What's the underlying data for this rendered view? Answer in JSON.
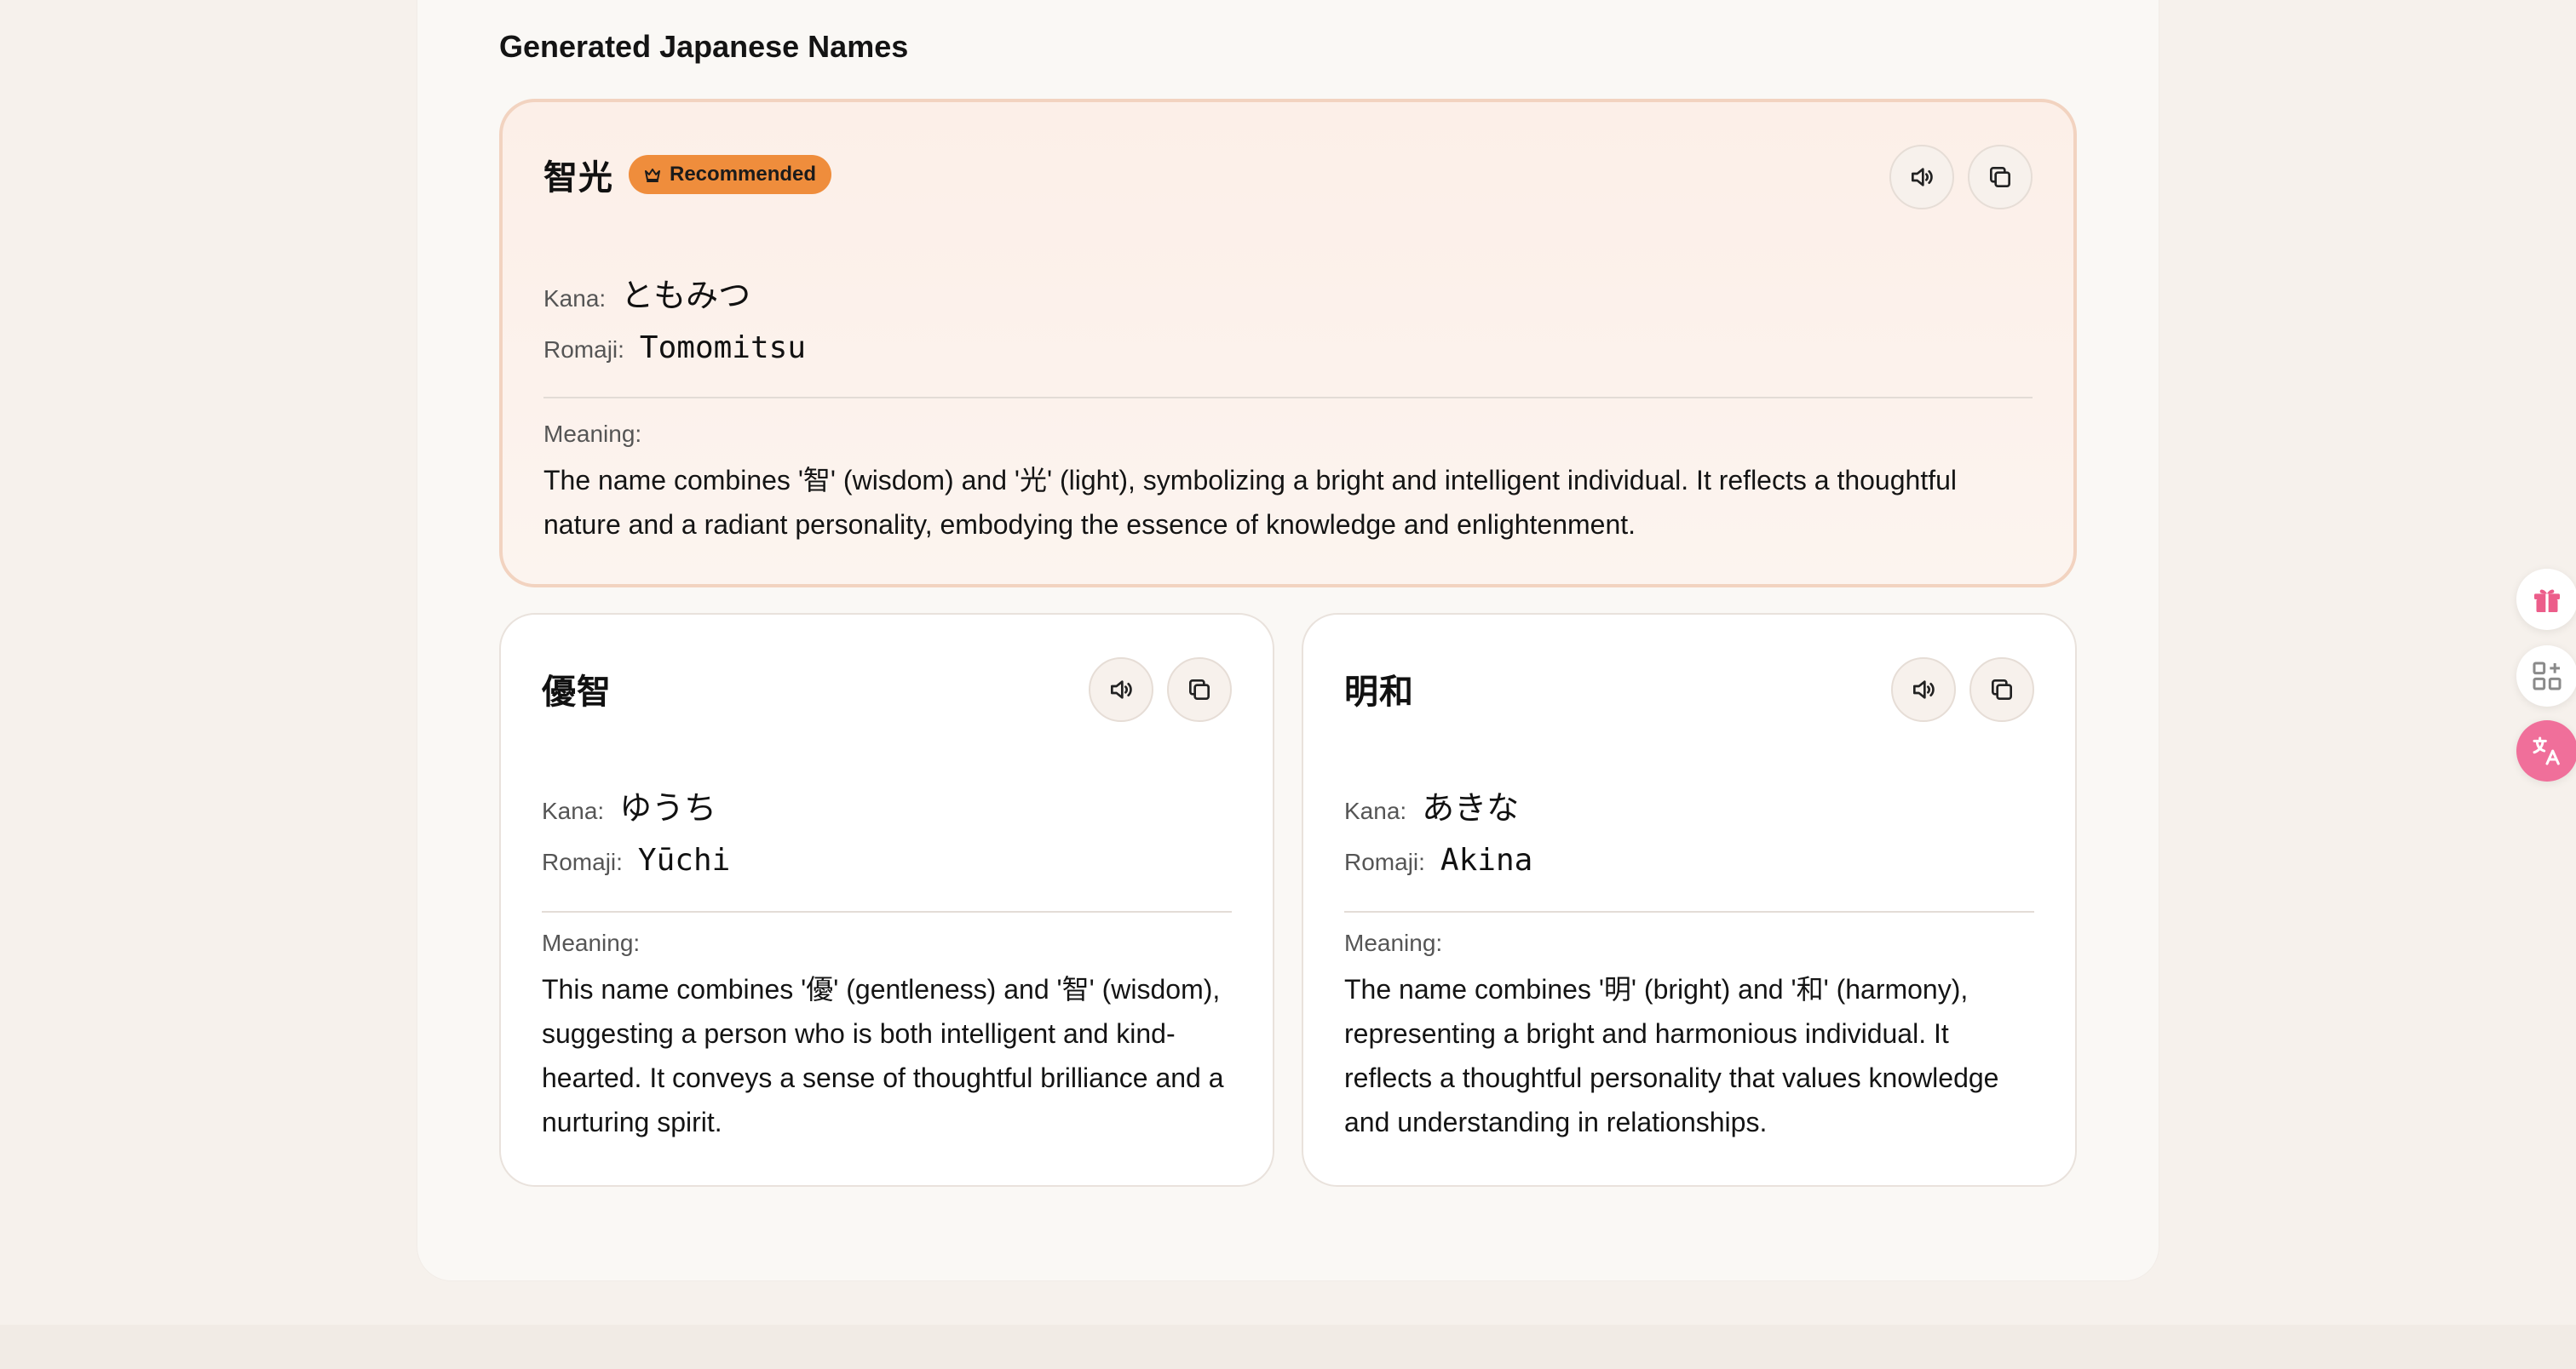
{
  "section": {
    "title": "Generated Japanese Names"
  },
  "labels": {
    "kana": "Kana:",
    "romaji": "Romaji:",
    "meaning": "Meaning:"
  },
  "names": [
    {
      "kanji": "智光",
      "badge": "Recommended",
      "kana": "ともみつ",
      "romaji": "Tomomitsu",
      "meaning": "The name combines '智' (wisdom) and '光' (light), symbolizing a bright and intelligent individual. It reflects a thoughtful nature and a radiant personality, embodying the essence of knowledge and enlightenment."
    },
    {
      "kanji": "優智",
      "kana": "ゆうち",
      "romaji": "Yūchi",
      "meaning": "This name combines '優' (gentleness) and '智' (wisdom), suggesting a person who is both intelligent and kind-hearted. It conveys a sense of thoughtful brilliance and a nurturing spirit."
    },
    {
      "kanji": "明和",
      "kana": "あきな",
      "romaji": "Akina",
      "meaning": "The name combines '明' (bright) and '和' (harmony), representing a bright and harmonious individual. It reflects a thoughtful personality that values knowledge and understanding in relationships."
    }
  ],
  "icons": {
    "speak": "speaker-icon",
    "copy": "copy-icon",
    "badge": "crown-icon",
    "float": [
      "gift-icon",
      "apps-icon",
      "translate-icon"
    ]
  },
  "colors": {
    "accent": "#ef8d3c",
    "featured_border": "#f2d3c0",
    "translate_button": "#f06f9a"
  }
}
